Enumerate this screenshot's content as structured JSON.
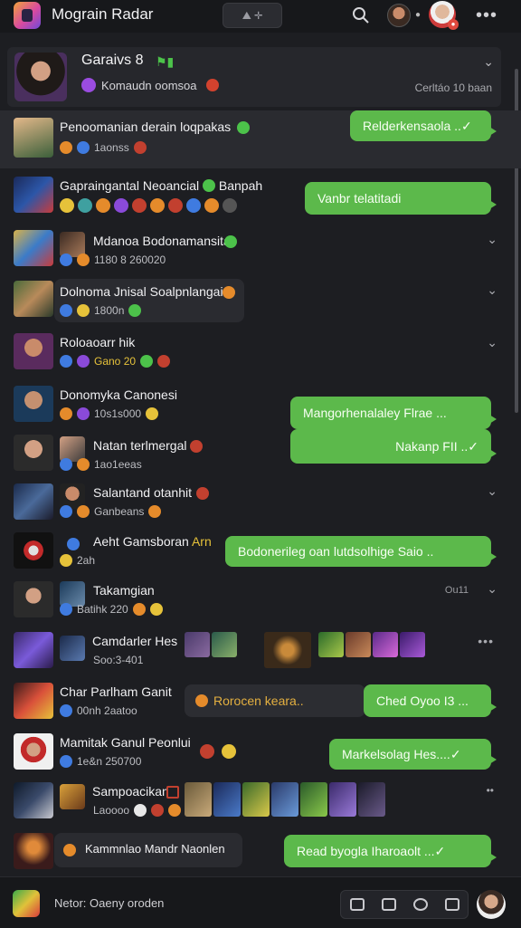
{
  "app": {
    "title": "Mograin Radar",
    "top_pill": "⛰ ✛"
  },
  "header": {
    "name": "Garaivs 8",
    "flag": "⚑▮",
    "subtitle": "Komaudn oomsoa",
    "meta": "Cerltáo 10 baan"
  },
  "rows": [
    {
      "name": "Penoomanian derain loqpakas",
      "sub": "1aonss",
      "bubble": "Relderkensaola ..✓"
    },
    {
      "name": "Gapraingantal Neoancial",
      "name2": "Banpah",
      "bubble": "Vanbr telatitadi"
    },
    {
      "name": "Mdanoa Bodonamansita",
      "sub": "1180 8 260020"
    },
    {
      "name": "Dolnoma Jnisal Soalpnlangai",
      "sub": "1800n"
    },
    {
      "name": "Roloaoarr hik",
      "sub": "Gano 20"
    },
    {
      "name": "Donomyka Canonesi",
      "sub": "10s1s000",
      "bubble": "Mangorhenalaley Flrae ...",
      "bubble2": "Nakanp FII ..✓"
    },
    {
      "name": "Natan terlmergal",
      "sub": "1ao1eeas"
    },
    {
      "name": "Salantand otanhit",
      "sub": "Ganbeans"
    },
    {
      "name": "Aeht Gamsboran",
      "name2": "Arn",
      "sub": "2ah",
      "bubble": "Bodonerileg oan lutdsolhige Saio .."
    },
    {
      "name": "Takamgian",
      "sub": "Batihk 220",
      "meta": "Ou11"
    },
    {
      "name": "Camdarler Hes",
      "sub": "Soo:3-401"
    },
    {
      "name": "Char Parlham Ganit",
      "sub": "00nh 2aatoo",
      "gray": "Rorocen keara..",
      "bubble": "Ched Oyoo I3 ..."
    },
    {
      "name": "Mamitak Ganul Peonlui",
      "sub": "1e&n 250700",
      "bubble": "Markelsolag Hes....✓"
    },
    {
      "name": "Sampoacikan",
      "sub": "Laoooo"
    },
    {
      "name": "Kammnlao Mandr Naonlen",
      "bubble": "Read byogla Iharoaolt ...✓"
    }
  ],
  "bottom": {
    "label": "Netor: Oaeny oroden"
  },
  "colors": {
    "accent_green": "#5cb94b",
    "bg": "#1d1e22",
    "bar": "#17181b"
  }
}
